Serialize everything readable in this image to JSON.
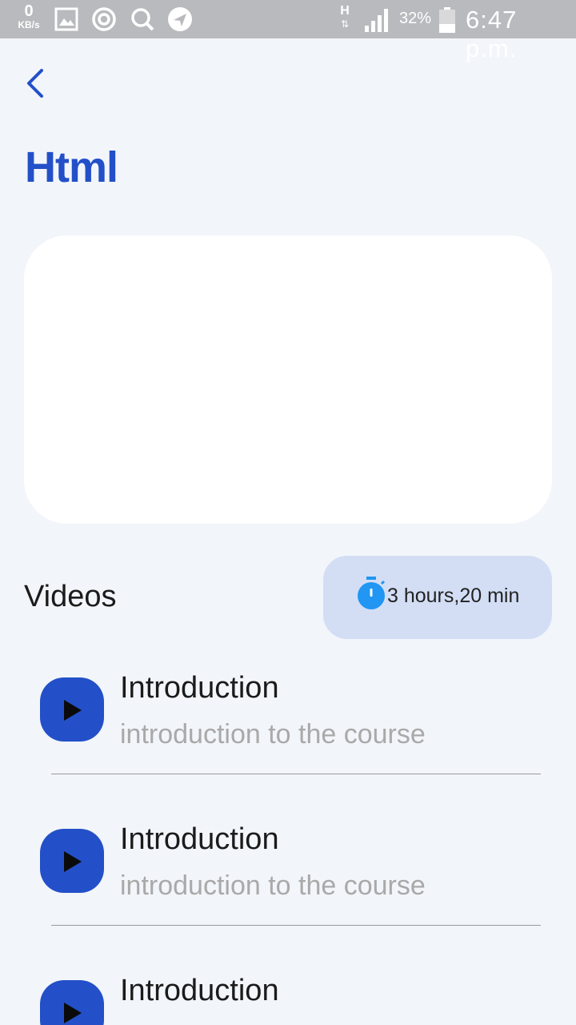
{
  "status_bar": {
    "data_speed_value": "0",
    "data_speed_unit": "KB/s",
    "network_type": "H",
    "battery_percent": "32%",
    "time": "6:47 p.m.",
    "icons": [
      "gallery-icon",
      "sync-icon",
      "search-icon",
      "location-icon",
      "signal-icon",
      "battery-icon"
    ]
  },
  "header": {
    "back_icon": "chevron-left-icon",
    "title": "Html"
  },
  "videos_section": {
    "label": "Videos",
    "duration": "3 hours,20 min",
    "duration_icon": "stopwatch-icon"
  },
  "videos": [
    {
      "title": "Introduction",
      "subtitle": "introduction to the course"
    },
    {
      "title": "Introduction",
      "subtitle": "introduction to the course"
    },
    {
      "title": "Introduction",
      "subtitle": ""
    }
  ],
  "colors": {
    "accent": "#2350c8",
    "background": "#f2f5fa",
    "pill": "#d3def5",
    "stopwatch": "#2196f3",
    "status_bar": "#b9babd"
  }
}
